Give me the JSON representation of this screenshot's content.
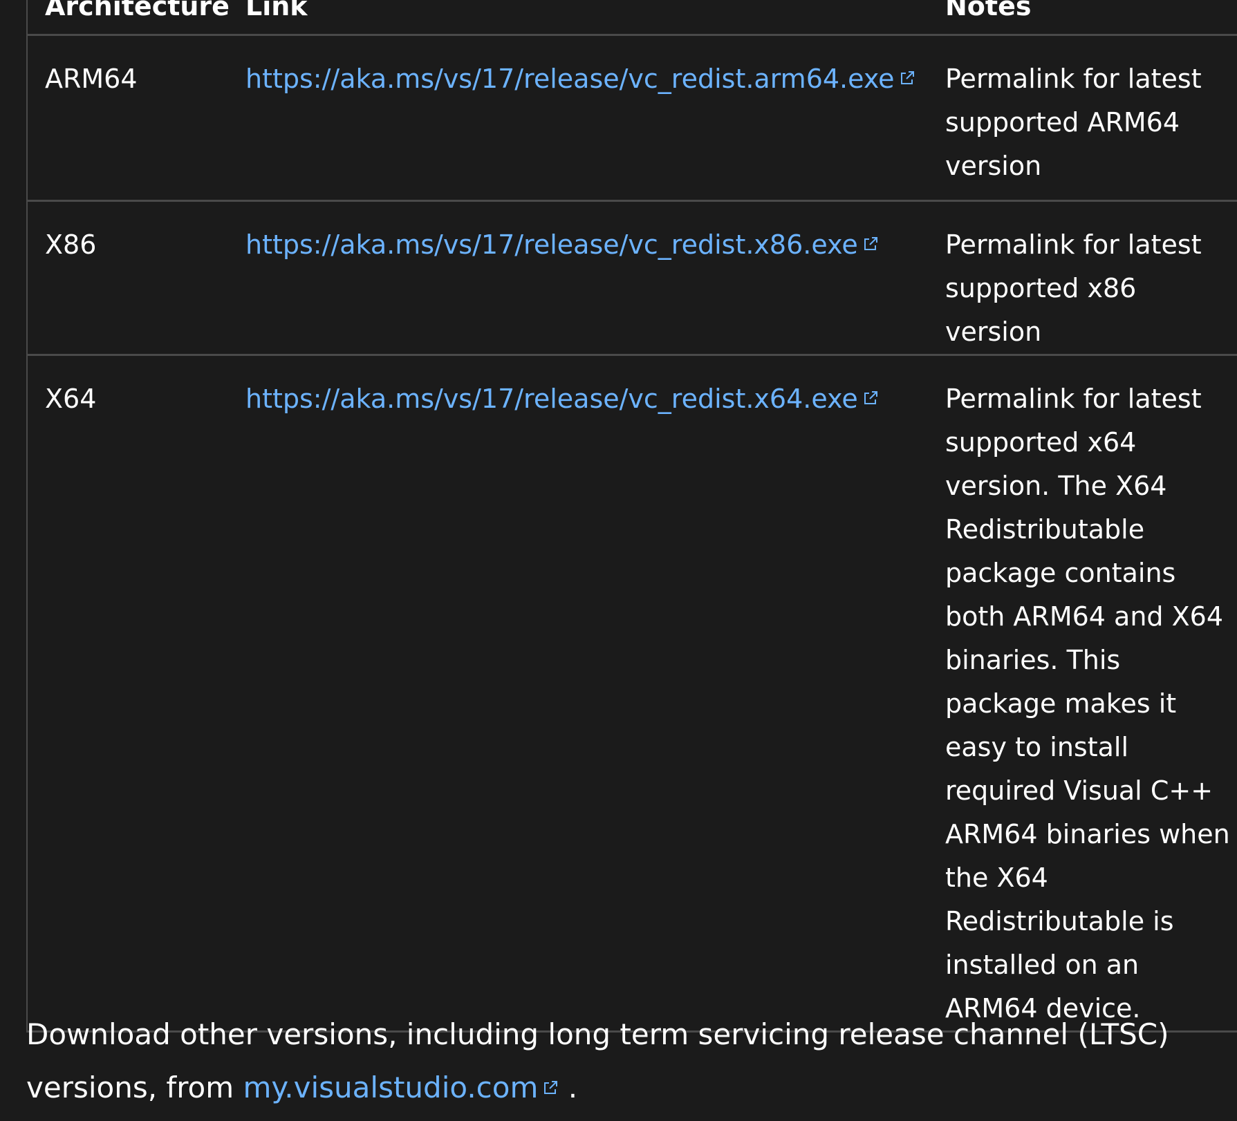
{
  "table": {
    "headers": {
      "architecture": "Architecture",
      "link": "Link",
      "notes": "Notes"
    },
    "rows": [
      {
        "architecture": "ARM64",
        "link": "https://aka.ms/vs/17/release/vc_redist.arm64.exe",
        "notes": "Permalink for latest supported ARM64 version"
      },
      {
        "architecture": "X86",
        "link": "https://aka.ms/vs/17/release/vc_redist.x86.exe",
        "notes": "Permalink for latest supported x86 version"
      },
      {
        "architecture": "X64",
        "link": "https://aka.ms/vs/17/release/vc_redist.x64.exe",
        "notes": "Permalink for latest supported x64 version. The X64 Redistributable package contains both ARM64 and X64 binaries. This package makes it easy to install required Visual C++ ARM64 binaries when the X64 Redistributable is installed on an ARM64 device."
      }
    ]
  },
  "footer": {
    "text_before": "Download other versions, including long term servicing release channel (LTSC) versions, from ",
    "link": "my.visualstudio.com",
    "text_after": " ."
  },
  "colors": {
    "background": "#1b1b1b",
    "text": "#ffffff",
    "link": "#6cb3ff",
    "border": "#4a4a4a"
  },
  "icons": {
    "external_link": "external-link-icon"
  }
}
